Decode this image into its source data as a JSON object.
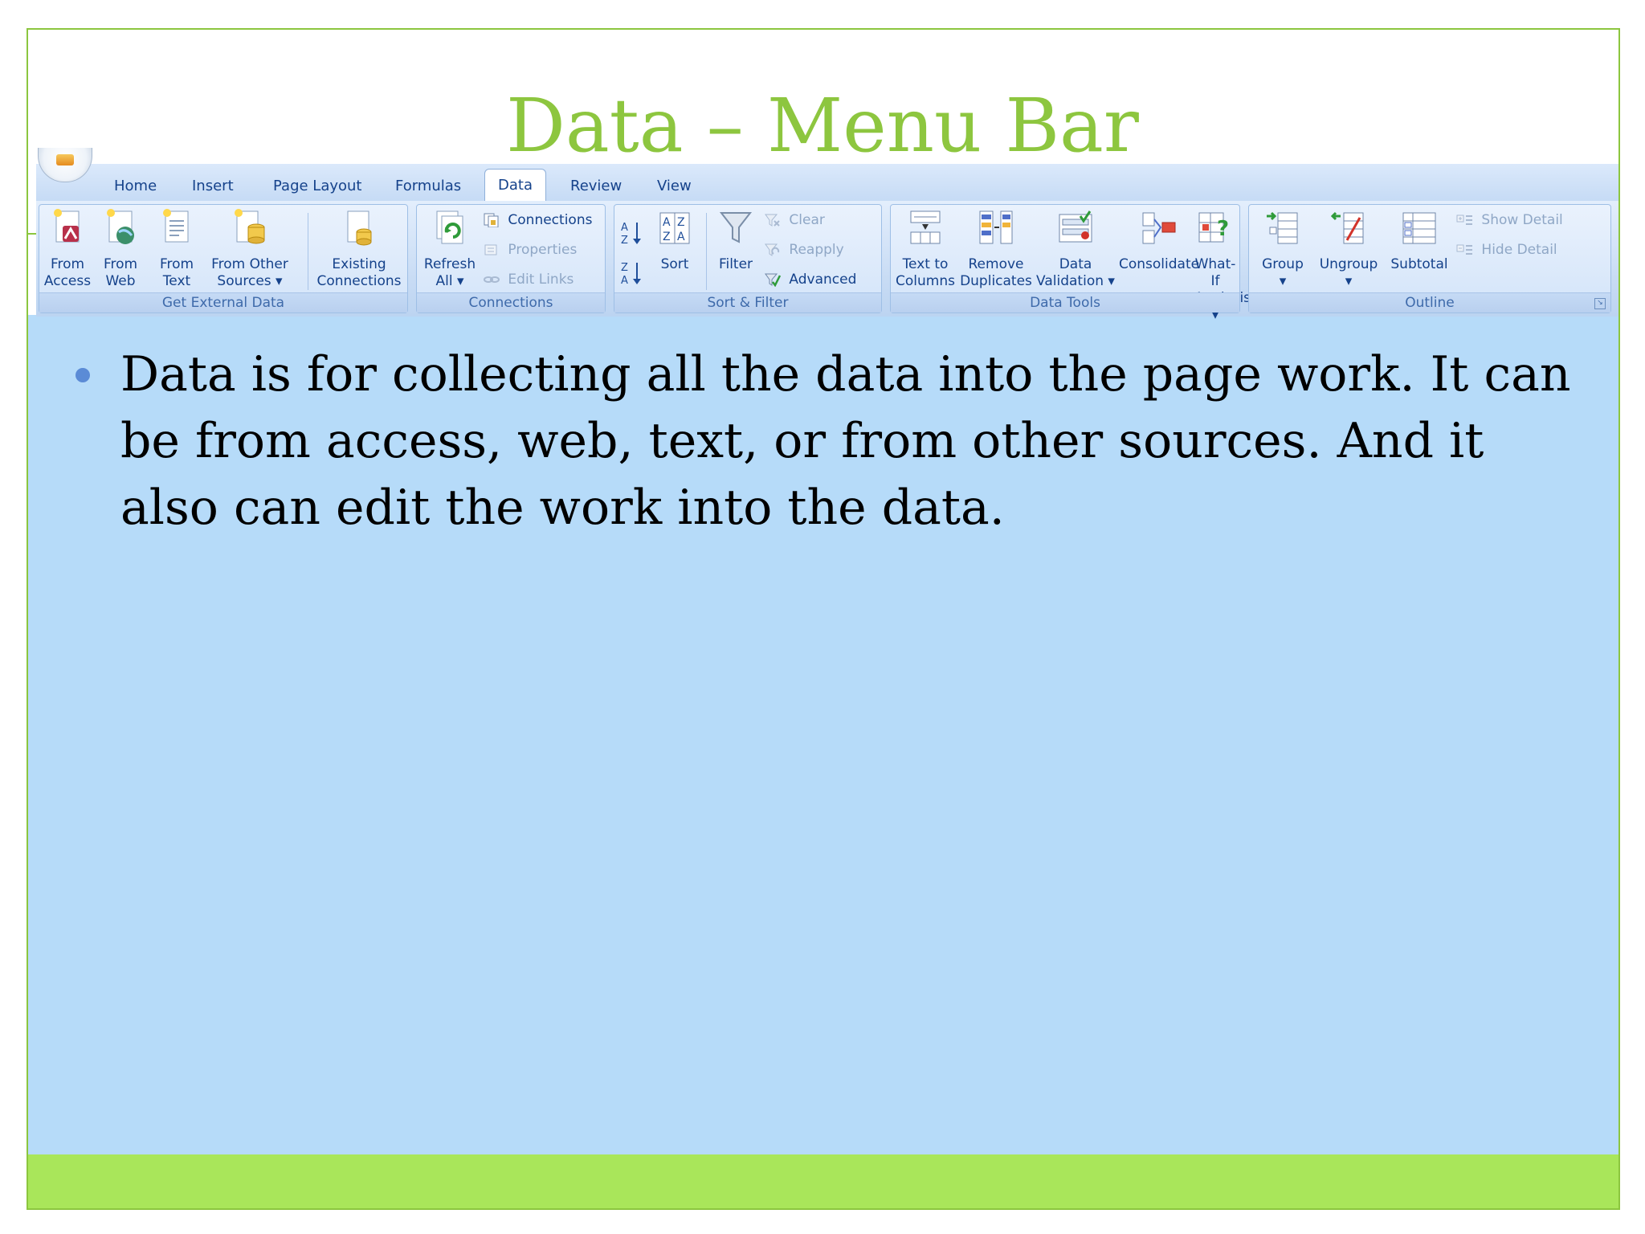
{
  "slide": {
    "title": "Data – Menu Bar",
    "bullets": [
      "Data is for collecting all the data into the page work. It can be from access, web, text, or from other sources. And it also can edit the work into the data."
    ]
  },
  "ribbon": {
    "tabs": [
      "Home",
      "Insert",
      "Page Layout",
      "Formulas",
      "Data",
      "Review",
      "View"
    ],
    "active_tab": "Data",
    "groups": {
      "get_external_data": {
        "label": "Get External Data",
        "buttons": {
          "from_access": [
            "From",
            "Access"
          ],
          "from_web": [
            "From",
            "Web"
          ],
          "from_text": [
            "From",
            "Text"
          ],
          "from_other": [
            "From Other",
            "Sources ▾"
          ],
          "existing": [
            "Existing",
            "Connections"
          ]
        }
      },
      "connections": {
        "label": "Connections",
        "refresh": [
          "Refresh",
          "All ▾"
        ],
        "connections": "Connections",
        "properties": "Properties",
        "edit_links": "Edit Links"
      },
      "sort_filter": {
        "label": "Sort & Filter",
        "sort": "Sort",
        "filter": "Filter",
        "clear": "Clear",
        "reapply": "Reapply",
        "advanced": "Advanced"
      },
      "data_tools": {
        "label": "Data Tools",
        "text_to_columns": [
          "Text to",
          "Columns"
        ],
        "remove_duplicates": [
          "Remove",
          "Duplicates"
        ],
        "data_validation": [
          "Data",
          "Validation ▾"
        ],
        "consolidate": "Consolidate",
        "what_if": [
          "What-If",
          "Analysis ▾"
        ]
      },
      "outline": {
        "label": "Outline",
        "group": [
          "Group",
          "▾"
        ],
        "ungroup": [
          "Ungroup",
          "▾"
        ],
        "subtotal": "Subtotal",
        "show_detail": "Show Detail",
        "hide_detail": "Hide Detail"
      }
    }
  },
  "colors": {
    "title": "#8dc63f",
    "frame": "#8cc63f",
    "content_bg": "#b6dbf9",
    "footer": "#a9e65a",
    "bullet": "#5b8bd6",
    "ribbon_text": "#15428b"
  }
}
